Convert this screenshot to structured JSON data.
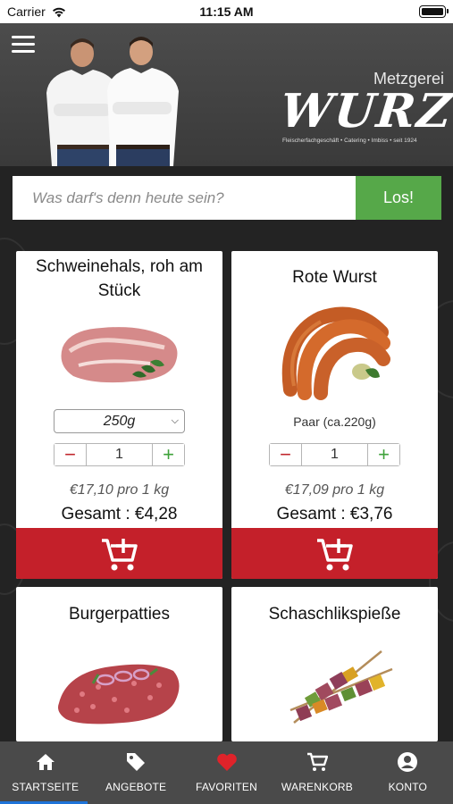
{
  "status_bar": {
    "carrier": "Carrier",
    "time": "11:15 AM"
  },
  "header": {
    "logo_sub": "Metzgerei",
    "logo_main": "WURZ",
    "logo_tagline": "Fleischerfachgeschäft • Catering • Imbiss • seit 1924"
  },
  "search": {
    "placeholder": "Was darf's denn heute sein?",
    "button_label": "Los!"
  },
  "products": [
    {
      "title": "Schweinehals, roh am Stück",
      "variant": "250g",
      "quantity": "1",
      "unit_price": "€17,10 pro 1 kg",
      "total": "Gesamt : €4,28"
    },
    {
      "title": "Rote Wurst",
      "variant": "Paar (ca.220g)",
      "quantity": "1",
      "unit_price": "€17,09 pro 1 kg",
      "total": "Gesamt : €3,76"
    },
    {
      "title": "Burgerpatties"
    },
    {
      "title": "Schaschlikspieße"
    }
  ],
  "tabs": [
    {
      "label": "STARTSEITE",
      "icon": "home-icon"
    },
    {
      "label": "ANGEBOTE",
      "icon": "tag-icon"
    },
    {
      "label": "FAVORITEN",
      "icon": "heart-icon"
    },
    {
      "label": "WARENKORB",
      "icon": "cart-icon"
    },
    {
      "label": "KONTO",
      "icon": "account-icon"
    }
  ],
  "colors": {
    "accent_red": "#c4202a",
    "button_green": "#56a849",
    "tabbar_bg": "#4a4a4a",
    "favorite_heart": "#e0232a"
  }
}
